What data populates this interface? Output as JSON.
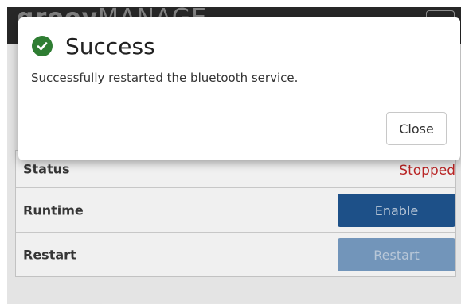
{
  "app": {
    "logo_bold": "groov",
    "logo_thin": "MANAGE"
  },
  "service": {
    "status_label": "Status",
    "status_value": "Stopped",
    "status_color": "#c62828",
    "runtime_label": "Runtime",
    "enable_label": "Enable",
    "restart_label": "Restart",
    "restart_button_label": "Restart"
  },
  "modal": {
    "title": "Success",
    "icon": "check-circle-icon",
    "message": "Successfully restarted the bluetooth service.",
    "close_label": "Close"
  }
}
